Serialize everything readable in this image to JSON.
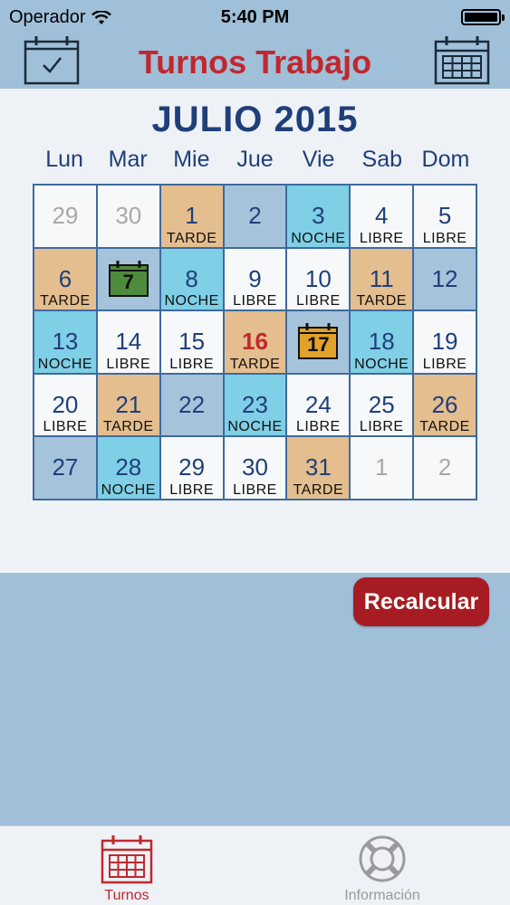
{
  "status": {
    "carrier": "Operador",
    "time": "5:40 PM"
  },
  "nav": {
    "title": "Turnos Trabajo",
    "left_icon": "calendar-check-icon",
    "right_icon": "calendar-grid-icon"
  },
  "calendar": {
    "month_title": "JULIO 2015",
    "weekdays": [
      "Lun",
      "Mar",
      "Mie",
      "Jue",
      "Vie",
      "Sab",
      "Dom"
    ],
    "days": [
      {
        "num": "29",
        "shift": "",
        "type": "other"
      },
      {
        "num": "30",
        "shift": "",
        "type": "other"
      },
      {
        "num": "1",
        "shift": "TARDE",
        "type": "tarde"
      },
      {
        "num": "2",
        "shift": "",
        "type": "weekend"
      },
      {
        "num": "3",
        "shift": "NOCHE",
        "type": "noche"
      },
      {
        "num": "4",
        "shift": "LIBRE",
        "type": "libre"
      },
      {
        "num": "5",
        "shift": "LIBRE",
        "type": "libre"
      },
      {
        "num": "6",
        "shift": "TARDE",
        "type": "tarde"
      },
      {
        "num": "7",
        "shift": "",
        "type": "weekend",
        "badge": "green"
      },
      {
        "num": "8",
        "shift": "NOCHE",
        "type": "noche"
      },
      {
        "num": "9",
        "shift": "LIBRE",
        "type": "libre"
      },
      {
        "num": "10",
        "shift": "LIBRE",
        "type": "libre"
      },
      {
        "num": "11",
        "shift": "TARDE",
        "type": "tarde"
      },
      {
        "num": "12",
        "shift": "",
        "type": "weekend"
      },
      {
        "num": "13",
        "shift": "NOCHE",
        "type": "noche"
      },
      {
        "num": "14",
        "shift": "LIBRE",
        "type": "libre"
      },
      {
        "num": "15",
        "shift": "LIBRE",
        "type": "libre"
      },
      {
        "num": "16",
        "shift": "TARDE",
        "type": "tarde",
        "today": true
      },
      {
        "num": "17",
        "shift": "",
        "type": "weekend",
        "badge": "orange"
      },
      {
        "num": "18",
        "shift": "NOCHE",
        "type": "noche"
      },
      {
        "num": "19",
        "shift": "LIBRE",
        "type": "libre"
      },
      {
        "num": "20",
        "shift": "LIBRE",
        "type": "libre"
      },
      {
        "num": "21",
        "shift": "TARDE",
        "type": "tarde"
      },
      {
        "num": "22",
        "shift": "",
        "type": "weekend"
      },
      {
        "num": "23",
        "shift": "NOCHE",
        "type": "noche"
      },
      {
        "num": "24",
        "shift": "LIBRE",
        "type": "libre"
      },
      {
        "num": "25",
        "shift": "LIBRE",
        "type": "libre"
      },
      {
        "num": "26",
        "shift": "TARDE",
        "type": "tarde"
      },
      {
        "num": "27",
        "shift": "",
        "type": "weekend"
      },
      {
        "num": "28",
        "shift": "NOCHE",
        "type": "noche"
      },
      {
        "num": "29",
        "shift": "LIBRE",
        "type": "libre"
      },
      {
        "num": "30",
        "shift": "LIBRE",
        "type": "libre"
      },
      {
        "num": "31",
        "shift": "TARDE",
        "type": "tarde"
      },
      {
        "num": "1",
        "shift": "",
        "type": "other"
      },
      {
        "num": "2",
        "shift": "",
        "type": "other"
      }
    ]
  },
  "recalc_label": "Recalcular",
  "tabs": [
    {
      "label": "Turnos",
      "icon": "calendar-grid-icon",
      "active": true
    },
    {
      "label": "Información",
      "icon": "lifebuoy-icon",
      "active": false
    }
  ],
  "colors": {
    "title_red": "#c0282e",
    "navy": "#1f3f79",
    "tarde": "#e4be8e",
    "noche": "#7fcfe6",
    "weekend": "#a6c3dc",
    "button": "#a71c22"
  }
}
